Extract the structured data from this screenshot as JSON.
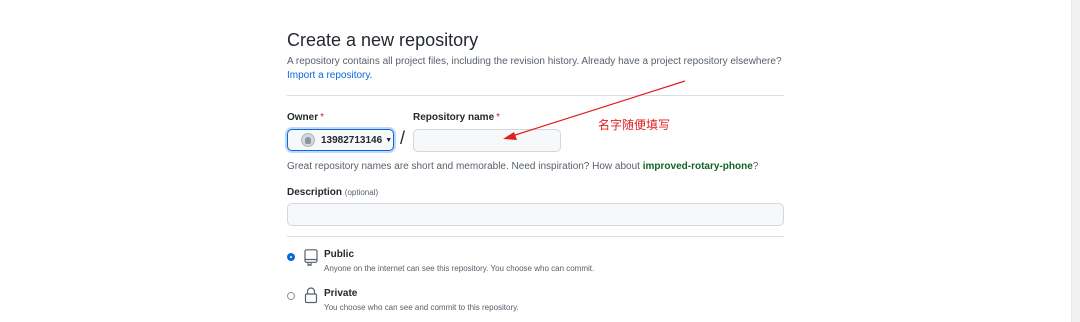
{
  "header": {
    "title": "Create a new repository",
    "description": "A repository contains all project files, including the revision history. Already have a project repository elsewhere?",
    "import_link": "Import a repository."
  },
  "owner": {
    "label": "Owner",
    "required_mark": "*",
    "selected": "13982713146"
  },
  "separator": "/",
  "repo_name": {
    "label": "Repository name",
    "required_mark": "*",
    "value": ""
  },
  "hint": {
    "text": "Great repository names are short and memorable. Need inspiration? How about ",
    "suggestion": "improved-rotary-phone",
    "suffix": "?"
  },
  "description_field": {
    "label": "Description",
    "optional": "(optional)",
    "value": ""
  },
  "visibility": [
    {
      "title": "Public",
      "desc": "Anyone on the internet can see this repository. You choose who can commit.",
      "selected": true,
      "icon": "repo-icon"
    },
    {
      "title": "Private",
      "desc": "You choose who can see and commit to this repository.",
      "selected": false,
      "icon": "lock-icon"
    }
  ],
  "annotation": {
    "text": "名字随便填写",
    "color": "#e02020"
  },
  "colors": {
    "link": "#0969da",
    "required": "#cf222e",
    "suggestion": "#116329"
  }
}
